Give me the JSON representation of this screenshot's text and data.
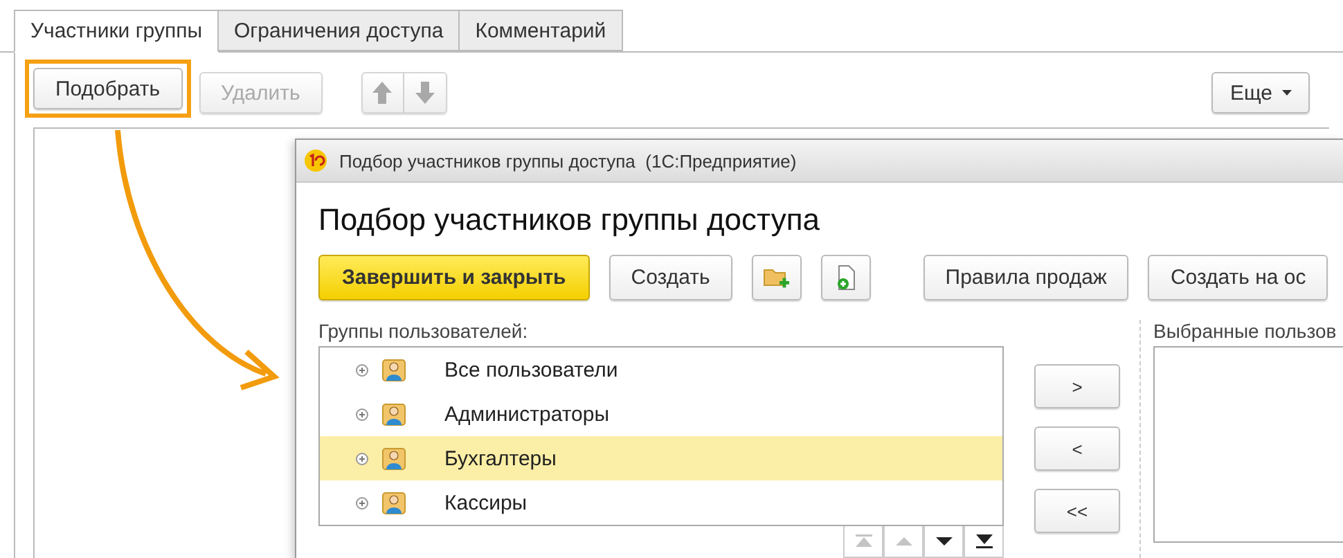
{
  "tabs": [
    {
      "label": "Участники группы",
      "selected": true
    },
    {
      "label": "Ограничения доступа",
      "selected": false
    },
    {
      "label": "Комментарий",
      "selected": false
    }
  ],
  "toolbar": {
    "pick_button": {
      "label": "Подобрать",
      "highlighted": true
    },
    "delete_button": {
      "label": "Удалить",
      "disabled": true
    },
    "move_up_disabled": true,
    "move_down_disabled": true,
    "more_button": {
      "label": "Еще"
    }
  },
  "dialog": {
    "window_title": "Подбор участников группы доступа  (1С:Предприятие)",
    "heading": "Подбор участников группы доступа",
    "buttons": [
      {
        "kind": "primary",
        "label": "Завершить и закрыть"
      },
      {
        "kind": "text",
        "label": "Создать"
      },
      {
        "kind": "folder-add"
      },
      {
        "kind": "item-add"
      },
      {
        "kind": "text",
        "label": "Правила продаж"
      },
      {
        "kind": "text",
        "label": "Создать на ос"
      }
    ],
    "groups_label": "Группы пользователей:",
    "groups": [
      {
        "label": "Все пользователи",
        "selected": false
      },
      {
        "label": "Администраторы",
        "selected": false
      },
      {
        "label": "Бухгалтеры",
        "selected": true
      },
      {
        "label": "Кассиры",
        "selected": false
      }
    ],
    "list_nav": [
      {
        "kind": "first",
        "disabled": true
      },
      {
        "kind": "up",
        "disabled": true
      },
      {
        "kind": "down",
        "disabled": false
      },
      {
        "kind": "last",
        "disabled": false
      }
    ],
    "transfer_buttons": [
      ">",
      "<",
      "<<"
    ],
    "selected_label": "Выбранные пользов"
  }
}
